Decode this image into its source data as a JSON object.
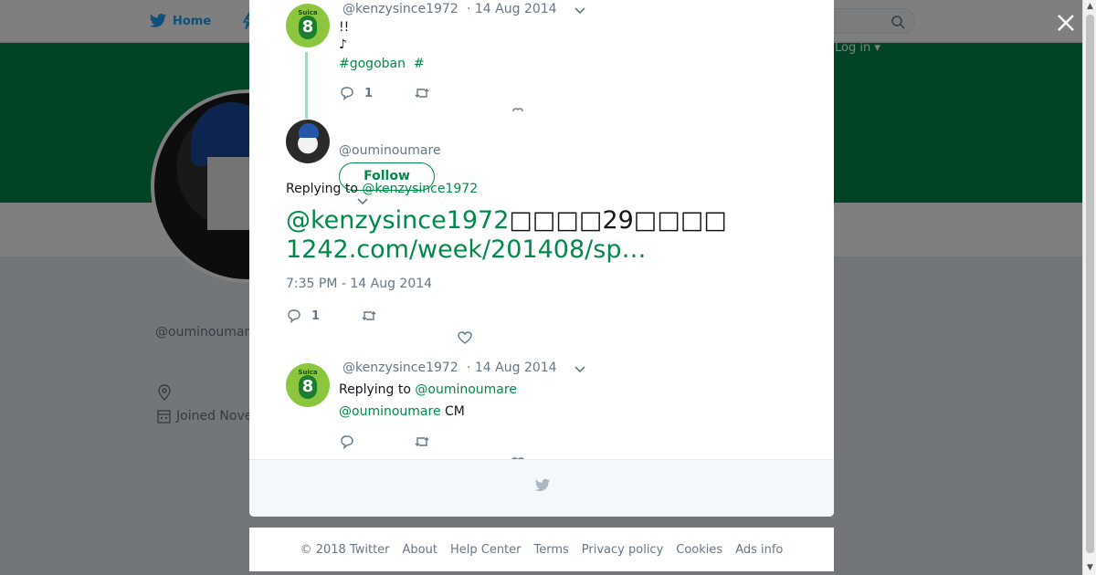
{
  "background": {
    "nav": {
      "home_label": "Home",
      "login_label": "Log in"
    },
    "profile": {
      "name": "",
      "handle": "@ouminoumare",
      "joined": "Joined Nove"
    }
  },
  "tweets": {
    "first": {
      "handle": "@kenzysince1972",
      "time": "· 14 Aug 2014",
      "line1": "!!",
      "line2": "♪",
      "hashtag1": "#gogoban",
      "hashtag2": "#",
      "reply_count": "1"
    },
    "main": {
      "handle": "@ouminoumare",
      "follow_label": "Follow",
      "replying_prefix": "Replying to",
      "replying_to": "@kenzysince1972",
      "text_mention": "@kenzysince1972",
      "text_middle": "□□□□29□□□□",
      "text_link": "1242.com/week/201408/sp…",
      "timestamp": "7:35 PM - 14 Aug 2014",
      "reply_count": "1"
    },
    "reply": {
      "handle": "@kenzysince1972",
      "time": "· 14 Aug 2014",
      "replying_prefix": "Replying to",
      "replying_to": "@ouminoumare",
      "text_mention": "@ouminoumare",
      "text_rest": " CM"
    }
  },
  "footer": {
    "links": [
      "© 2018 Twitter",
      "About",
      "Help Center",
      "Terms",
      "Privacy policy",
      "Cookies",
      "Ads info"
    ]
  },
  "colors": {
    "accent": "#00894a",
    "banner": "#00894a",
    "muted": "#657786",
    "twitter_blue": "#1da1f2"
  }
}
